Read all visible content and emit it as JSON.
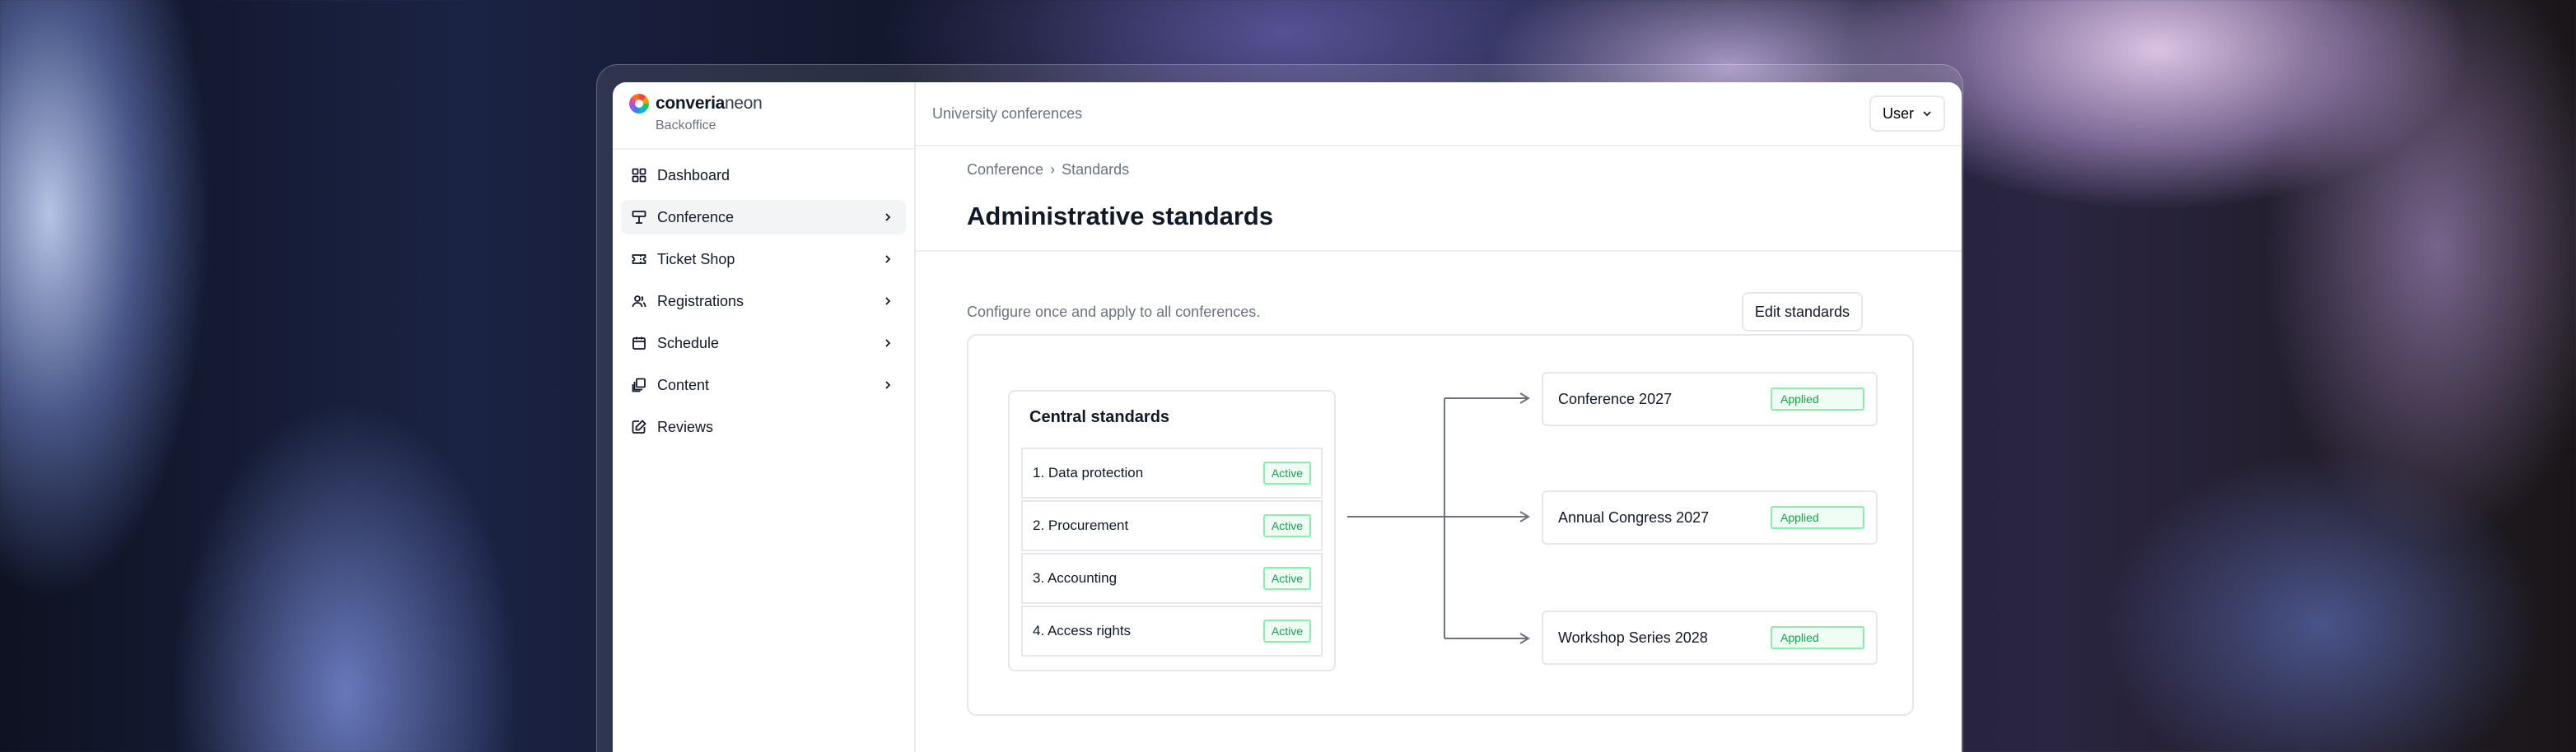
{
  "brand": {
    "name_bold": "converia",
    "name_light": "neon",
    "subtitle": "Backoffice"
  },
  "sidebar": {
    "items": [
      {
        "label": "Dashboard",
        "icon": "dashboard-icon",
        "has_chevron": false,
        "active": false
      },
      {
        "label": "Conference",
        "icon": "conference-icon",
        "has_chevron": true,
        "active": true
      },
      {
        "label": "Ticket Shop",
        "icon": "ticket-icon",
        "has_chevron": true,
        "active": false
      },
      {
        "label": "Registrations",
        "icon": "users-icon",
        "has_chevron": true,
        "active": false
      },
      {
        "label": "Schedule",
        "icon": "calendar-icon",
        "has_chevron": true,
        "active": false
      },
      {
        "label": "Content",
        "icon": "content-icon",
        "has_chevron": true,
        "active": false
      },
      {
        "label": "Reviews",
        "icon": "reviews-icon",
        "has_chevron": false,
        "active": false
      }
    ]
  },
  "topbar": {
    "title": "University conferences",
    "user_label": "User"
  },
  "header": {
    "breadcrumb": {
      "parent": "Conference",
      "separator": "›",
      "current": "Standards"
    },
    "title": "Administrative standards"
  },
  "content": {
    "subtitle": "Configure once and apply to all conferences.",
    "edit_button": "Edit standards",
    "central": {
      "title": "Central standards",
      "items": [
        {
          "label": "1. Data protection",
          "status": "Active"
        },
        {
          "label": "2. Procurement",
          "status": "Active"
        },
        {
          "label": "3. Accounting",
          "status": "Active"
        },
        {
          "label": "4. Access rights",
          "status": "Active"
        }
      ]
    },
    "targets": [
      {
        "label": "Conference 2027",
        "status": "Applied"
      },
      {
        "label": "Annual Congress 2027",
        "status": "Applied"
      },
      {
        "label": "Workshop Series 2028",
        "status": "Applied"
      }
    ]
  },
  "colors": {
    "accent_green": "#16a34a",
    "border": "#e5e7eb",
    "muted": "#6b7280"
  }
}
